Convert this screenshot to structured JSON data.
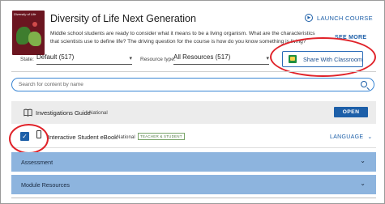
{
  "course": {
    "title": "Diversity of Life Next Generation",
    "image_caption": "Diversity of Life",
    "description": "Middle school students are ready to consider what it means to be a living organism. What are the characteristics that scientists use to define life? The driving question for the course is how do you know something is living?",
    "see_more_label": "SEE MORE",
    "launch_label": "LAUNCH COURSE"
  },
  "filters": {
    "state_label": "State:",
    "state_value": "Default (517)",
    "type_label": "Resource type:",
    "type_value": "All Resources (517)"
  },
  "share": {
    "label": "Share With Classroom"
  },
  "search": {
    "placeholder": "Search for content by name"
  },
  "resources": [
    {
      "name": "Investigations Guide",
      "tag": "National",
      "action_label": "OPEN"
    },
    {
      "name": "Interactive Student eBook",
      "tag": "National",
      "badge": "TEACHER & STUDENT",
      "action_label": "LANGUAGE",
      "checked": true
    }
  ],
  "sections": [
    {
      "label": "Assessment"
    },
    {
      "label": "Module Resources"
    }
  ],
  "colors": {
    "accent": "#1d5fa8",
    "section_band": "#8db4de",
    "annotation_red": "#e0232a"
  }
}
